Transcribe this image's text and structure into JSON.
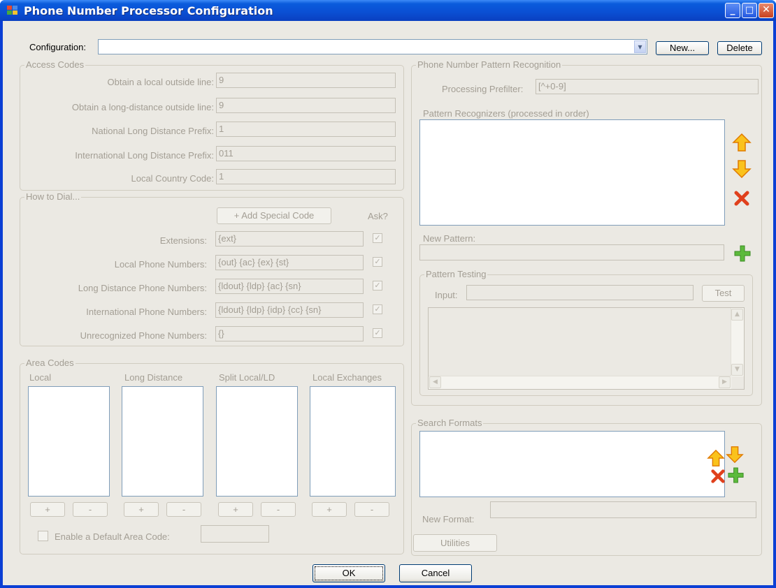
{
  "window": {
    "title": "Phone Number Processor Configuration",
    "minimize_glyph": "_",
    "maximize_glyph": "□",
    "close_glyph": "✕"
  },
  "config": {
    "label": "Configuration:",
    "value": "",
    "dropdown_glyph": "▾",
    "new_label": "New...",
    "delete_label": "Delete"
  },
  "access_codes": {
    "title": "Access Codes",
    "fields": [
      {
        "label": "Obtain a local outside line:",
        "value": "9"
      },
      {
        "label": "Obtain a long-distance outside line:",
        "value": "9"
      },
      {
        "label": "National Long Distance Prefix:",
        "value": "1"
      },
      {
        "label": "International Long Distance Prefix:",
        "value": "011"
      },
      {
        "label": "Local Country Code:",
        "value": "1"
      }
    ]
  },
  "how_to_dial": {
    "title": "How to Dial...",
    "add_special_label": "+ Add Special Code",
    "ask_label": "Ask?",
    "rows": [
      {
        "label": "Extensions:",
        "value": "{ext}",
        "ask": true
      },
      {
        "label": "Local Phone Numbers:",
        "value": "{out} {ac} {ex} {st}",
        "ask": true
      },
      {
        "label": "Long Distance Phone Numbers:",
        "value": "{ldout} {ldp} {ac} {sn}",
        "ask": true
      },
      {
        "label": "International Phone Numbers:",
        "value": "{ldout} {ldp} {idp} {cc} {sn}",
        "ask": true
      },
      {
        "label": "Unrecognized Phone Numbers:",
        "value": "{}",
        "ask": true
      }
    ],
    "check_glyph": "✓"
  },
  "area_codes": {
    "title": "Area Codes",
    "columns": [
      {
        "label": "Local",
        "add": "+",
        "remove": "-"
      },
      {
        "label": "Long Distance",
        "add": "+",
        "remove": "-"
      },
      {
        "label": "Split Local/LD",
        "add": "+",
        "remove": "-"
      },
      {
        "label": "Local Exchanges",
        "add": "+",
        "remove": "-"
      }
    ],
    "enable_default_label": "Enable a Default Area Code:",
    "default_value": ""
  },
  "pattern_recognition": {
    "title": "Phone Number Pattern Recognition",
    "prefilter_label": "Processing Prefilter:",
    "prefilter_value": "[^+0-9]",
    "recognizers_label": "Pattern Recognizers (processed in order)",
    "new_pattern_label": "New Pattern:",
    "new_pattern_value": ""
  },
  "pattern_testing": {
    "title": "Pattern Testing",
    "input_label": "Input:",
    "input_value": "",
    "test_label": "Test",
    "scroll_up": "▲",
    "scroll_down": "▼",
    "scroll_left": "◀",
    "scroll_right": "▶"
  },
  "search_formats": {
    "title": "Search Formats",
    "new_format_label": "New Format:",
    "new_format_value": ""
  },
  "footer": {
    "utilities_label": "Utilities",
    "ok_label": "OK",
    "cancel_label": "Cancel"
  },
  "colors": {
    "titlebar": "#0a4fd3",
    "client": "#ebe9e3",
    "arrow": "#f5b000",
    "delete": "#e0401c",
    "add": "#3fa02a"
  }
}
